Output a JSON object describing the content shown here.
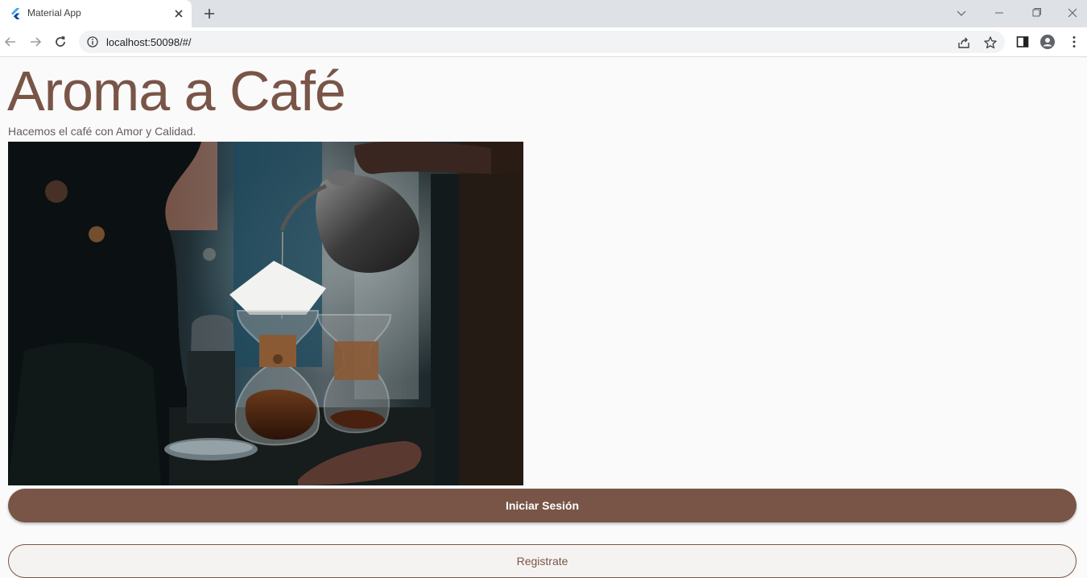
{
  "browser": {
    "tab": {
      "title": "Material App",
      "favicon": "flutter-icon"
    },
    "address": "localhost:50098/#/",
    "icons": {
      "back": "back-arrow-icon",
      "forward": "forward-arrow-icon",
      "reload": "reload-icon",
      "info": "info-icon",
      "share": "share-icon",
      "bookmark": "star-icon",
      "side_panel": "side-panel-icon",
      "profile": "profile-icon",
      "menu": "kebab-menu-icon"
    }
  },
  "app": {
    "title": "Aroma a Café",
    "subtitle": "Hacemos el café con Amor y Calidad.",
    "hero_image": "coffee-pour-over-photo",
    "login_button": "Iniciar Sesión",
    "register_button": "Registrate"
  },
  "colors": {
    "accent": "#795548",
    "background": "#fafafa"
  }
}
